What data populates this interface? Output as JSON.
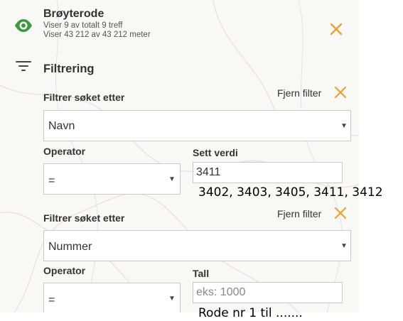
{
  "layer": {
    "title": "Brøyterode",
    "count_text": "Viser 9 av totalt 9 treff",
    "length_text": "Viser 43 212 av 43 212 meter"
  },
  "filter_section": {
    "title": "Filtrering"
  },
  "filters": [
    {
      "field_label": "Filtrer søket etter",
      "remove_label": "Fjern filter",
      "field_value": "Navn",
      "operator_label": "Operator",
      "operator_value": "=",
      "value_label": "Sett verdi",
      "value_input": "3411",
      "value_placeholder": ""
    },
    {
      "field_label": "Filtrer søket etter",
      "remove_label": "Fjern filter",
      "field_value": "Nummer",
      "operator_label": "Operator",
      "operator_value": "=",
      "value_label": "Tall",
      "value_input": "",
      "value_placeholder": "eks: 1000"
    }
  ],
  "annotations": {
    "values_list": "3402, 3403, 3405, 3411, 3412",
    "rode_note": "Rode nr 1 til ......."
  },
  "colors": {
    "accent": "#f0a030",
    "eye": "#3a9a3e"
  },
  "icons": {
    "layer": "eye-icon",
    "close": "close-icon",
    "filter": "filter-icon",
    "dropdown": "chevron-down-icon"
  }
}
